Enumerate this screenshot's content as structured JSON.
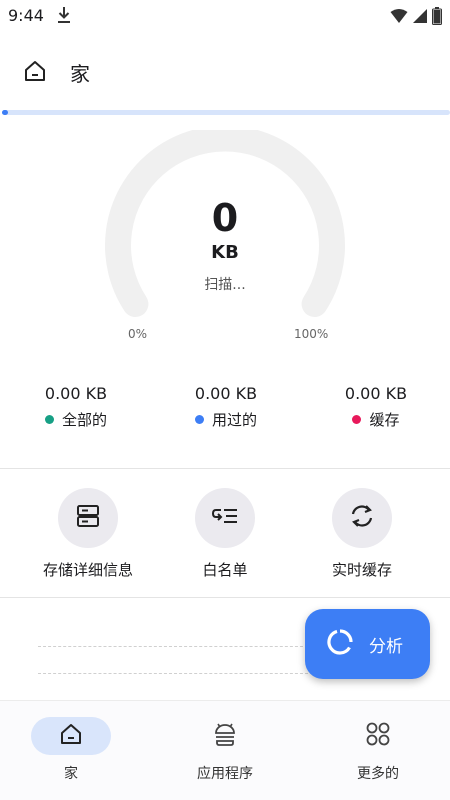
{
  "status_bar": {
    "time": "9:44"
  },
  "header": {
    "title": "家"
  },
  "scan": {
    "progress_fraction": 0.01
  },
  "gauge": {
    "value": "0",
    "unit": "KB",
    "status": "扫描...",
    "min_label": "0%",
    "max_label": "100%",
    "fill_fraction": 0
  },
  "stats": [
    {
      "value": "0.00 KB",
      "label": "全部的",
      "color": "#17a085"
    },
    {
      "value": "0.00 KB",
      "label": "用过的",
      "color": "#3d7ef5"
    },
    {
      "value": "0.00 KB",
      "label": "缓存",
      "color": "#e8195b"
    }
  ],
  "actions": [
    {
      "label": "存储详细信息",
      "icon": "storage-icon"
    },
    {
      "label": "白名单",
      "icon": "whitelist-icon"
    },
    {
      "label": "实时缓存",
      "icon": "sync-icon"
    }
  ],
  "fab": {
    "label": "分析",
    "icon": "analyze-ring-icon"
  },
  "bottom_nav": [
    {
      "label": "家",
      "icon": "home-icon",
      "active": true
    },
    {
      "label": "应用程序",
      "icon": "android-apps-icon",
      "active": false
    },
    {
      "label": "更多的",
      "icon": "more-grid-icon",
      "active": false
    }
  ],
  "colors": {
    "accent": "#3d7ef5",
    "track": "#f0f0f0"
  }
}
